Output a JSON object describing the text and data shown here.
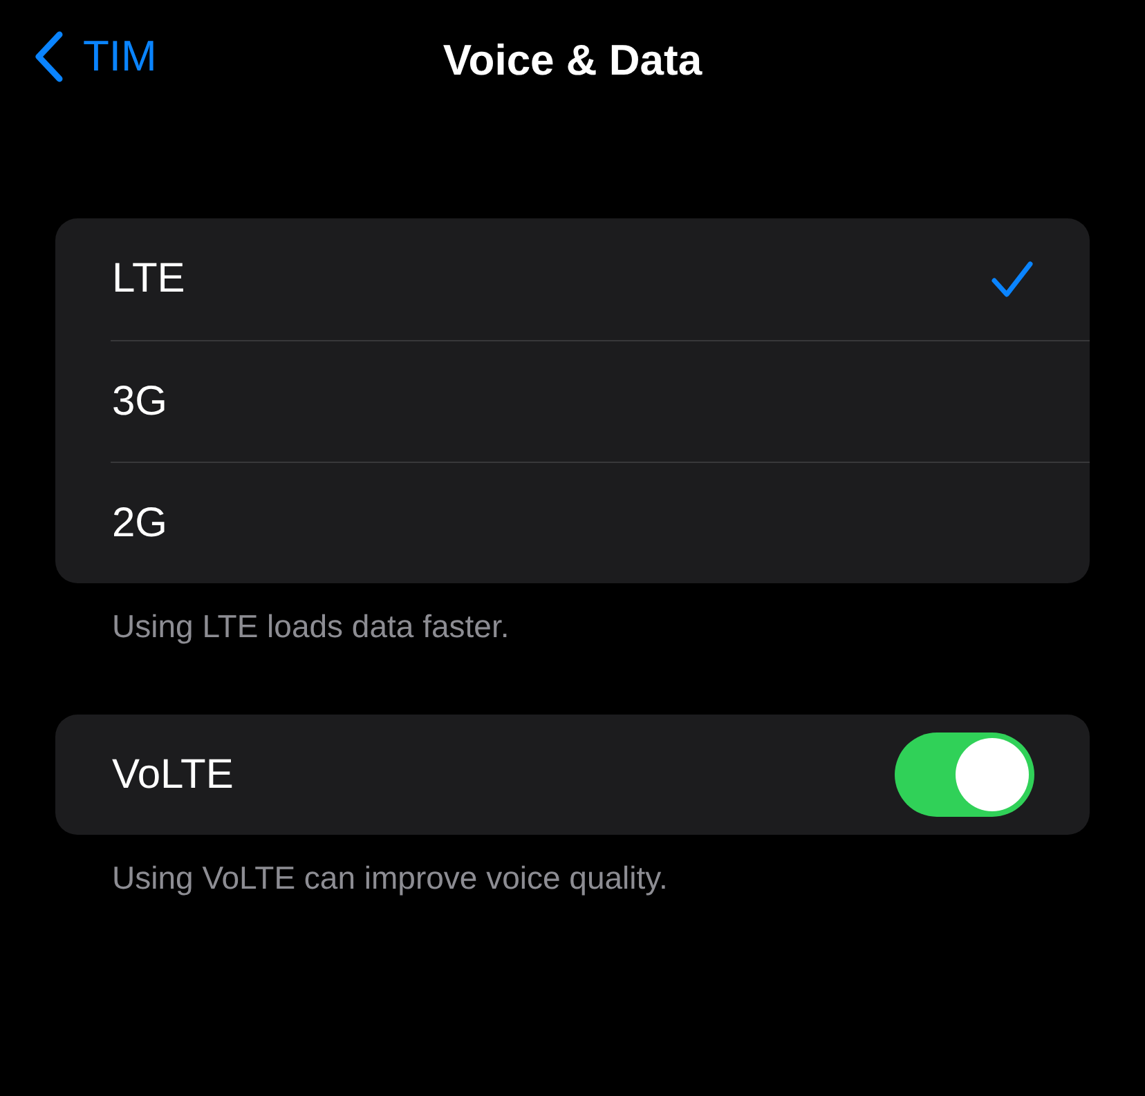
{
  "nav": {
    "back_label": "TIM",
    "title": "Voice & Data"
  },
  "network_options": [
    {
      "label": "LTE",
      "selected": true
    },
    {
      "label": "3G",
      "selected": false
    },
    {
      "label": "2G",
      "selected": false
    }
  ],
  "network_footer": "Using LTE loads data faster.",
  "volte": {
    "label": "VoLTE",
    "on": true
  },
  "volte_footer": "Using VoLTE can improve voice quality."
}
